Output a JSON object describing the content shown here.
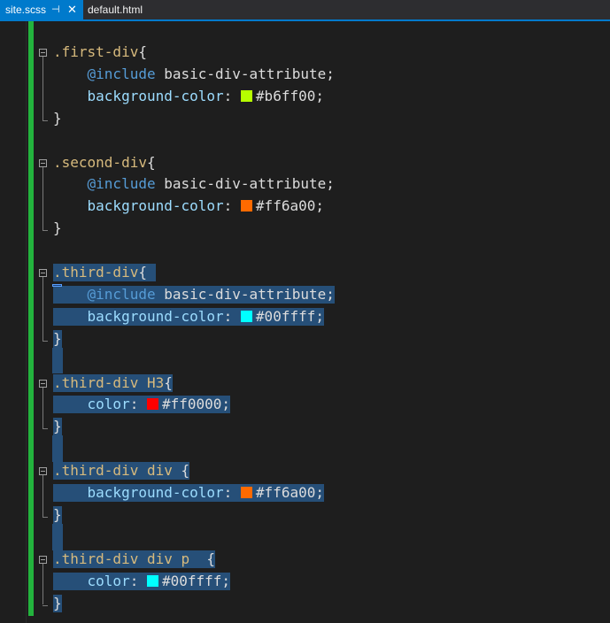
{
  "tabs": [
    {
      "label": "site.scss",
      "active": true,
      "pin_icon": "pin-icon",
      "close_icon": "close-icon"
    },
    {
      "label": "default.html",
      "active": false
    }
  ],
  "colors": {
    "accent": "#007acc",
    "selection": "#264f78",
    "change_bar": "#23b33d",
    "editor_bg": "#1e1e1e"
  },
  "editor": {
    "language": "scss",
    "blocks": [
      {
        "selected": false,
        "lines": [
          [
            {
              "t": ".first-div",
              "c": "sel"
            },
            {
              "t": "{",
              "c": "punct"
            }
          ],
          [
            {
              "t": "    "
            },
            {
              "t": "@include",
              "c": "kw"
            },
            {
              "t": " basic-div-attribute",
              "c": "val"
            },
            {
              "t": ";",
              "c": "punct"
            }
          ],
          [
            {
              "t": "    "
            },
            {
              "t": "background-color",
              "c": "prop"
            },
            {
              "t": ": ",
              "c": "punct"
            },
            {
              "swatch": "#b6ff00"
            },
            {
              "t": "#b6ff00",
              "c": "val"
            },
            {
              "t": ";",
              "c": "punct"
            }
          ],
          [
            {
              "t": "}",
              "c": "punct"
            }
          ]
        ]
      },
      {
        "selected": false,
        "lines": [
          [
            {
              "t": ".second-div",
              "c": "sel"
            },
            {
              "t": "{",
              "c": "punct"
            }
          ],
          [
            {
              "t": "    "
            },
            {
              "t": "@include",
              "c": "kw"
            },
            {
              "t": " basic-div-attribute",
              "c": "val"
            },
            {
              "t": ";",
              "c": "punct"
            }
          ],
          [
            {
              "t": "    "
            },
            {
              "t": "background-color",
              "c": "prop"
            },
            {
              "t": ": ",
              "c": "punct"
            },
            {
              "swatch": "#ff6a00"
            },
            {
              "t": "#ff6a00",
              "c": "val"
            },
            {
              "t": ";",
              "c": "punct"
            }
          ],
          [
            {
              "t": "}",
              "c": "punct"
            }
          ]
        ]
      },
      {
        "selected": true,
        "lines": [
          [
            {
              "t": ".third-div",
              "c": "sel"
            },
            {
              "t": "{ ",
              "c": "punct"
            }
          ],
          [
            {
              "t": "    "
            },
            {
              "t": "@include",
              "c": "kw"
            },
            {
              "t": " basic-div-attribute",
              "c": "val"
            },
            {
              "t": ";",
              "c": "punct"
            }
          ],
          [
            {
              "t": "    "
            },
            {
              "t": "background-color",
              "c": "prop"
            },
            {
              "t": ": ",
              "c": "punct"
            },
            {
              "swatch": "#00ffff"
            },
            {
              "t": "#00ffff",
              "c": "val"
            },
            {
              "t": ";",
              "c": "punct"
            }
          ],
          [
            {
              "t": "}",
              "c": "punct"
            }
          ]
        ]
      },
      {
        "selected": true,
        "lines": [
          [
            {
              "t": ".third-div",
              "c": "sel"
            },
            {
              "t": " H3",
              "c": "sel"
            },
            {
              "t": "{",
              "c": "punct"
            }
          ],
          [
            {
              "t": "    "
            },
            {
              "t": "color",
              "c": "prop"
            },
            {
              "t": ": ",
              "c": "punct"
            },
            {
              "swatch": "#ff0000"
            },
            {
              "t": "#ff0000",
              "c": "val"
            },
            {
              "t": ";",
              "c": "punct"
            }
          ],
          [
            {
              "t": "}",
              "c": "punct"
            }
          ]
        ]
      },
      {
        "selected": true,
        "lines": [
          [
            {
              "t": ".third-div",
              "c": "sel"
            },
            {
              "t": " div",
              "c": "sel"
            },
            {
              "t": " {",
              "c": "punct"
            }
          ],
          [
            {
              "t": "    "
            },
            {
              "t": "background-color",
              "c": "prop"
            },
            {
              "t": ": ",
              "c": "punct"
            },
            {
              "swatch": "#ff6a00"
            },
            {
              "t": "#ff6a00",
              "c": "val"
            },
            {
              "t": ";",
              "c": "punct"
            }
          ],
          [
            {
              "t": "}",
              "c": "punct"
            }
          ]
        ]
      },
      {
        "selected": true,
        "lines": [
          [
            {
              "t": ".third-div",
              "c": "sel"
            },
            {
              "t": " div p",
              "c": "sel"
            },
            {
              "t": "  {",
              "c": "punct"
            }
          ],
          [
            {
              "t": "    "
            },
            {
              "t": "color",
              "c": "prop"
            },
            {
              "t": ": ",
              "c": "punct"
            },
            {
              "swatch": "#00ffff"
            },
            {
              "t": "#00ffff",
              "c": "val"
            },
            {
              "t": ";",
              "c": "punct"
            }
          ],
          [
            {
              "t": "}",
              "c": "punct"
            }
          ]
        ]
      }
    ]
  }
}
